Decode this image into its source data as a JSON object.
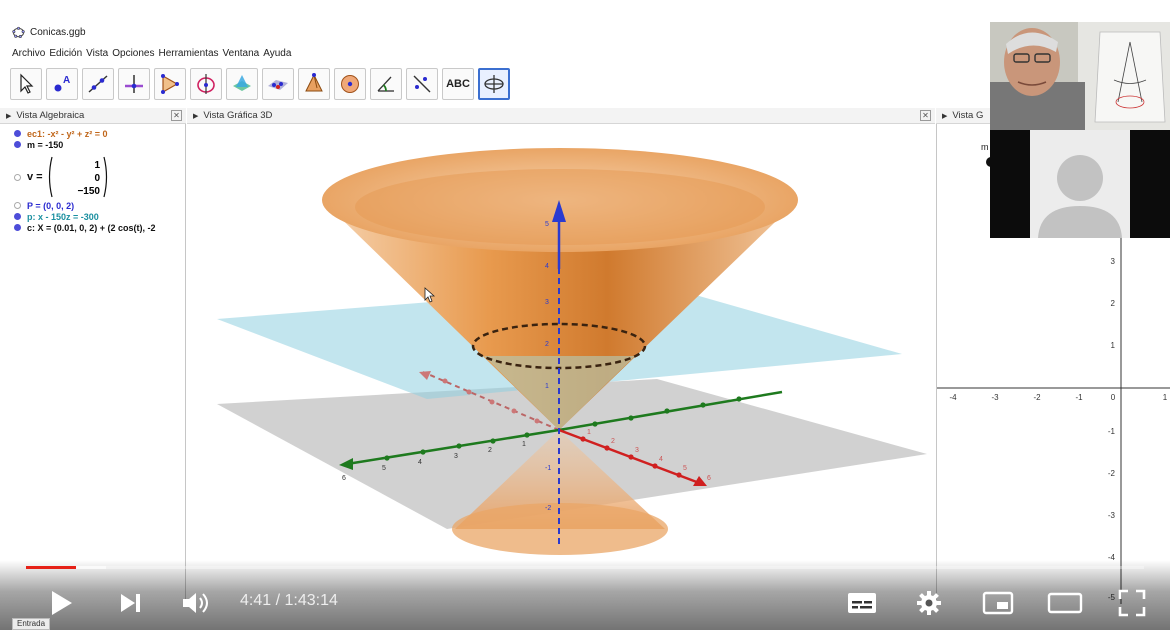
{
  "window": {
    "title": "Conicas.ggb"
  },
  "menu": [
    "Archivo",
    "Edición",
    "Vista",
    "Opciones",
    "Herramientas",
    "Ventana",
    "Ayuda"
  ],
  "toolbar": {
    "tools": [
      "move-tool",
      "point-tool",
      "line-tool",
      "perpendicular-tool",
      "polygon-tool",
      "circle-axis-tool",
      "intersect-tool",
      "plane-tool",
      "pyramid-tool",
      "sphere-tool",
      "angle-tool",
      "reflect-tool",
      "text-tool",
      "rotate-view-tool"
    ],
    "text_tool_label": "ABC",
    "active": "rotate-view-tool"
  },
  "algebra_view": {
    "title": "Vista Algebraica",
    "rows": [
      {
        "text": "ec1: -x² - y² + z² = 0",
        "color": "#c0661a",
        "visible": true
      },
      {
        "text": "m = -150",
        "color": "#111111",
        "visible": true
      },
      {
        "text": "v =",
        "color": "#111111",
        "visible": false,
        "vector": [
          "1",
          "0",
          "−150"
        ]
      },
      {
        "text": "P = (0, 0, 2)",
        "color": "#2a2ad0",
        "visible": false
      },
      {
        "text": "p: x - 150z = -300",
        "color": "#1a8fa0",
        "visible": true
      },
      {
        "text": "c: X = (0.01, 0, 2) + (2 cos(t), -2",
        "color": "#111111",
        "visible": true
      }
    ]
  },
  "view3d": {
    "title": "Vista Gráfica 3D",
    "x_ticks": [
      "1",
      "2",
      "3",
      "4",
      "5",
      "6"
    ],
    "y_ticks": [
      "1",
      "2",
      "3",
      "4",
      "5",
      "6"
    ],
    "z_ticks": [
      "1",
      "2",
      "3",
      "4",
      "5"
    ],
    "z_neg_ticks": [
      "-1",
      "-2"
    ],
    "colors": {
      "cone": "#e89a4e",
      "plane": "#8fd0e0",
      "x_axis": "#d02020",
      "y_axis": "#1e7a1e",
      "z_axis": "#2a3ad0"
    }
  },
  "view2d": {
    "title": "Vista G",
    "x_ticks": [
      "-4",
      "-3",
      "-2",
      "-1",
      "0",
      "1"
    ],
    "y_ticks": [
      "3",
      "2",
      "1",
      "-1",
      "-2",
      "-3",
      "-4",
      "-5"
    ],
    "slider_label": "m"
  },
  "player": {
    "current_time": "4:41",
    "duration": "1:43:14",
    "time_text": "4:41 / 1:43:14",
    "progress_fraction": 0.045,
    "buffer_fraction": 0.072
  },
  "input_bar": {
    "label": "Entrada"
  }
}
